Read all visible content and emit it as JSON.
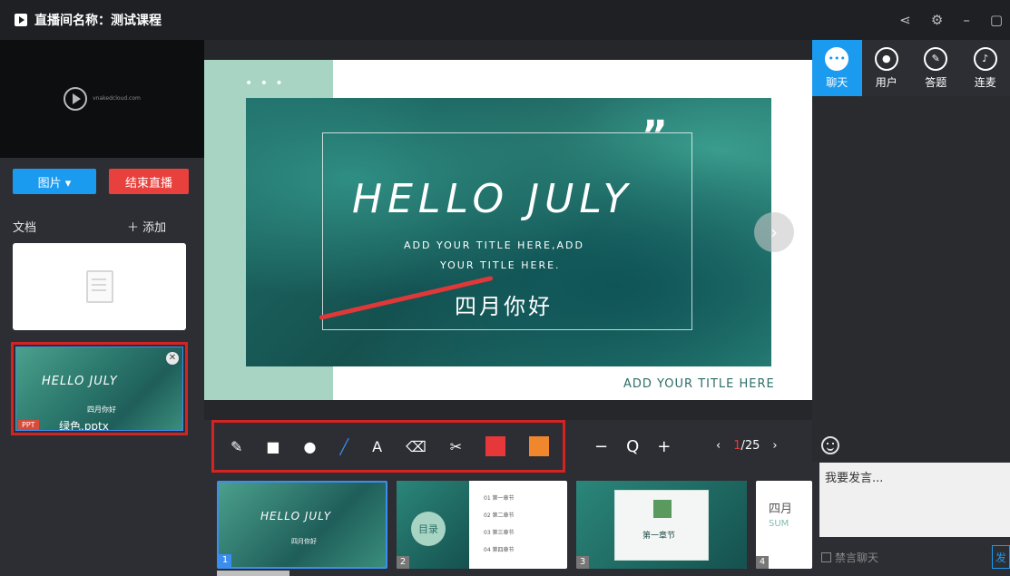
{
  "window": {
    "title": "直播间名称：测试课程",
    "controls": [
      "share-icon",
      "gear-icon",
      "minimize-icon",
      "maximize-icon"
    ]
  },
  "left": {
    "preview_logo": "vnakedcloud.com",
    "picture_button": "图片 ▾",
    "end_live_button": "结束直播",
    "docs_label": "文档",
    "add_button": "＋ 添加",
    "ppt_card": {
      "tag": "PPT",
      "file_name": "绿色.pptx",
      "mini_title": "HELLO JULY",
      "mini_cn": "四月你好"
    }
  },
  "slide": {
    "quote_mark": "”",
    "title": "HELLO JULY",
    "subtitle_line1": "ADD YOUR TITLE HERE,ADD",
    "subtitle_line2": "YOUR TITLE HERE.",
    "chinese": "四月你好",
    "footer": "ADD YOUR TITLE HERE"
  },
  "toolbar": {
    "tools": [
      "pencil-icon",
      "rectangle-icon",
      "circle-icon",
      "line-icon",
      "text-icon",
      "eraser-icon",
      "clear-icon"
    ],
    "text_tool": "A",
    "colors": [
      "#e6373a",
      "#f0872c"
    ],
    "zoom_out": "−",
    "zoom_icon": "Q",
    "zoom_in": "+",
    "prev": "‹",
    "current_page": "1",
    "total_pages": "/25",
    "next": "›"
  },
  "thumbnails": [
    {
      "number": "1",
      "title": "HELLO JULY",
      "cn": "四月你好",
      "active": true
    },
    {
      "number": "2",
      "bubble": "目录",
      "toc": [
        "01 第一章节",
        "02 第二章节",
        "03 第三章节",
        "04 第四章节"
      ]
    },
    {
      "number": "3",
      "heading": "第一章节"
    },
    {
      "number": "4",
      "heading": "四月",
      "sub": "SUM"
    }
  ],
  "right": {
    "tabs": [
      {
        "label": "聊天",
        "active": true,
        "icon": "chat-icon"
      },
      {
        "label": "用户",
        "active": false,
        "icon": "users-icon"
      },
      {
        "label": "答题",
        "active": false,
        "icon": "pen-icon"
      },
      {
        "label": "连麦",
        "active": false,
        "icon": "mic-icon"
      }
    ],
    "input_placeholder": "我要发言...",
    "mute_label": "禁言聊天",
    "send_label": "发"
  },
  "colors": {
    "accent_blue": "#1a9bf0",
    "end_red": "#e8413d",
    "highlight_red": "#d42323"
  }
}
